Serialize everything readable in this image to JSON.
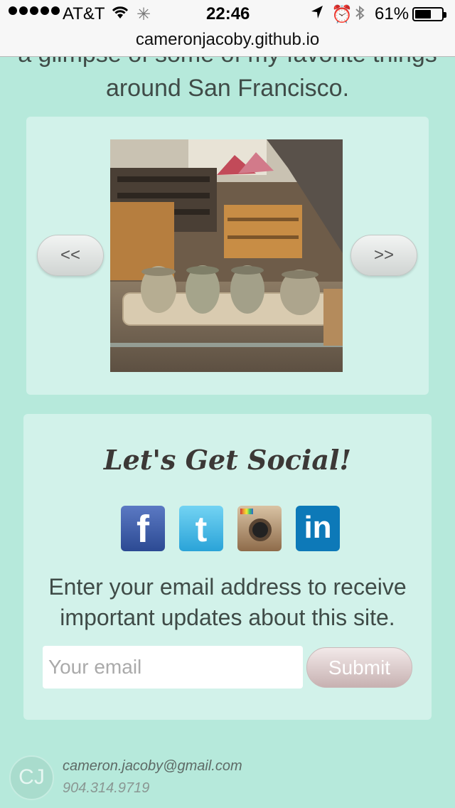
{
  "status_bar": {
    "carrier": "AT&T",
    "time": "22:46",
    "battery_percent": "61%",
    "battery_level": 0.61,
    "icons": [
      "signal-dots-icon",
      "wifi-icon",
      "spinner-icon",
      "location-arrow-icon",
      "alarm-icon",
      "bluetooth-icon",
      "battery-icon"
    ]
  },
  "url_bar": {
    "url": "cameronjacoby.github.io"
  },
  "intro": {
    "line1": "a glimpse of some of my favorite things",
    "line2": "around San Francisco."
  },
  "carousel": {
    "prev_label": "<<",
    "next_label": ">>"
  },
  "social": {
    "title": "Let's Get Social!",
    "icons": [
      "facebook-icon",
      "twitter-icon",
      "instagram-icon",
      "linkedin-icon"
    ],
    "subscribe_line1": "Enter your email address to receive",
    "subscribe_line2": "important updates about this site.",
    "email_placeholder": "Your email",
    "submit_label": "Submit"
  },
  "footer": {
    "avatar_initials": "CJ",
    "email": "cameron.jacoby@gmail.com",
    "phone": "904.314.9719"
  },
  "colors": {
    "background": "#b6e9db",
    "card": "#d2f2ea",
    "submit": "#c7b1b1"
  }
}
